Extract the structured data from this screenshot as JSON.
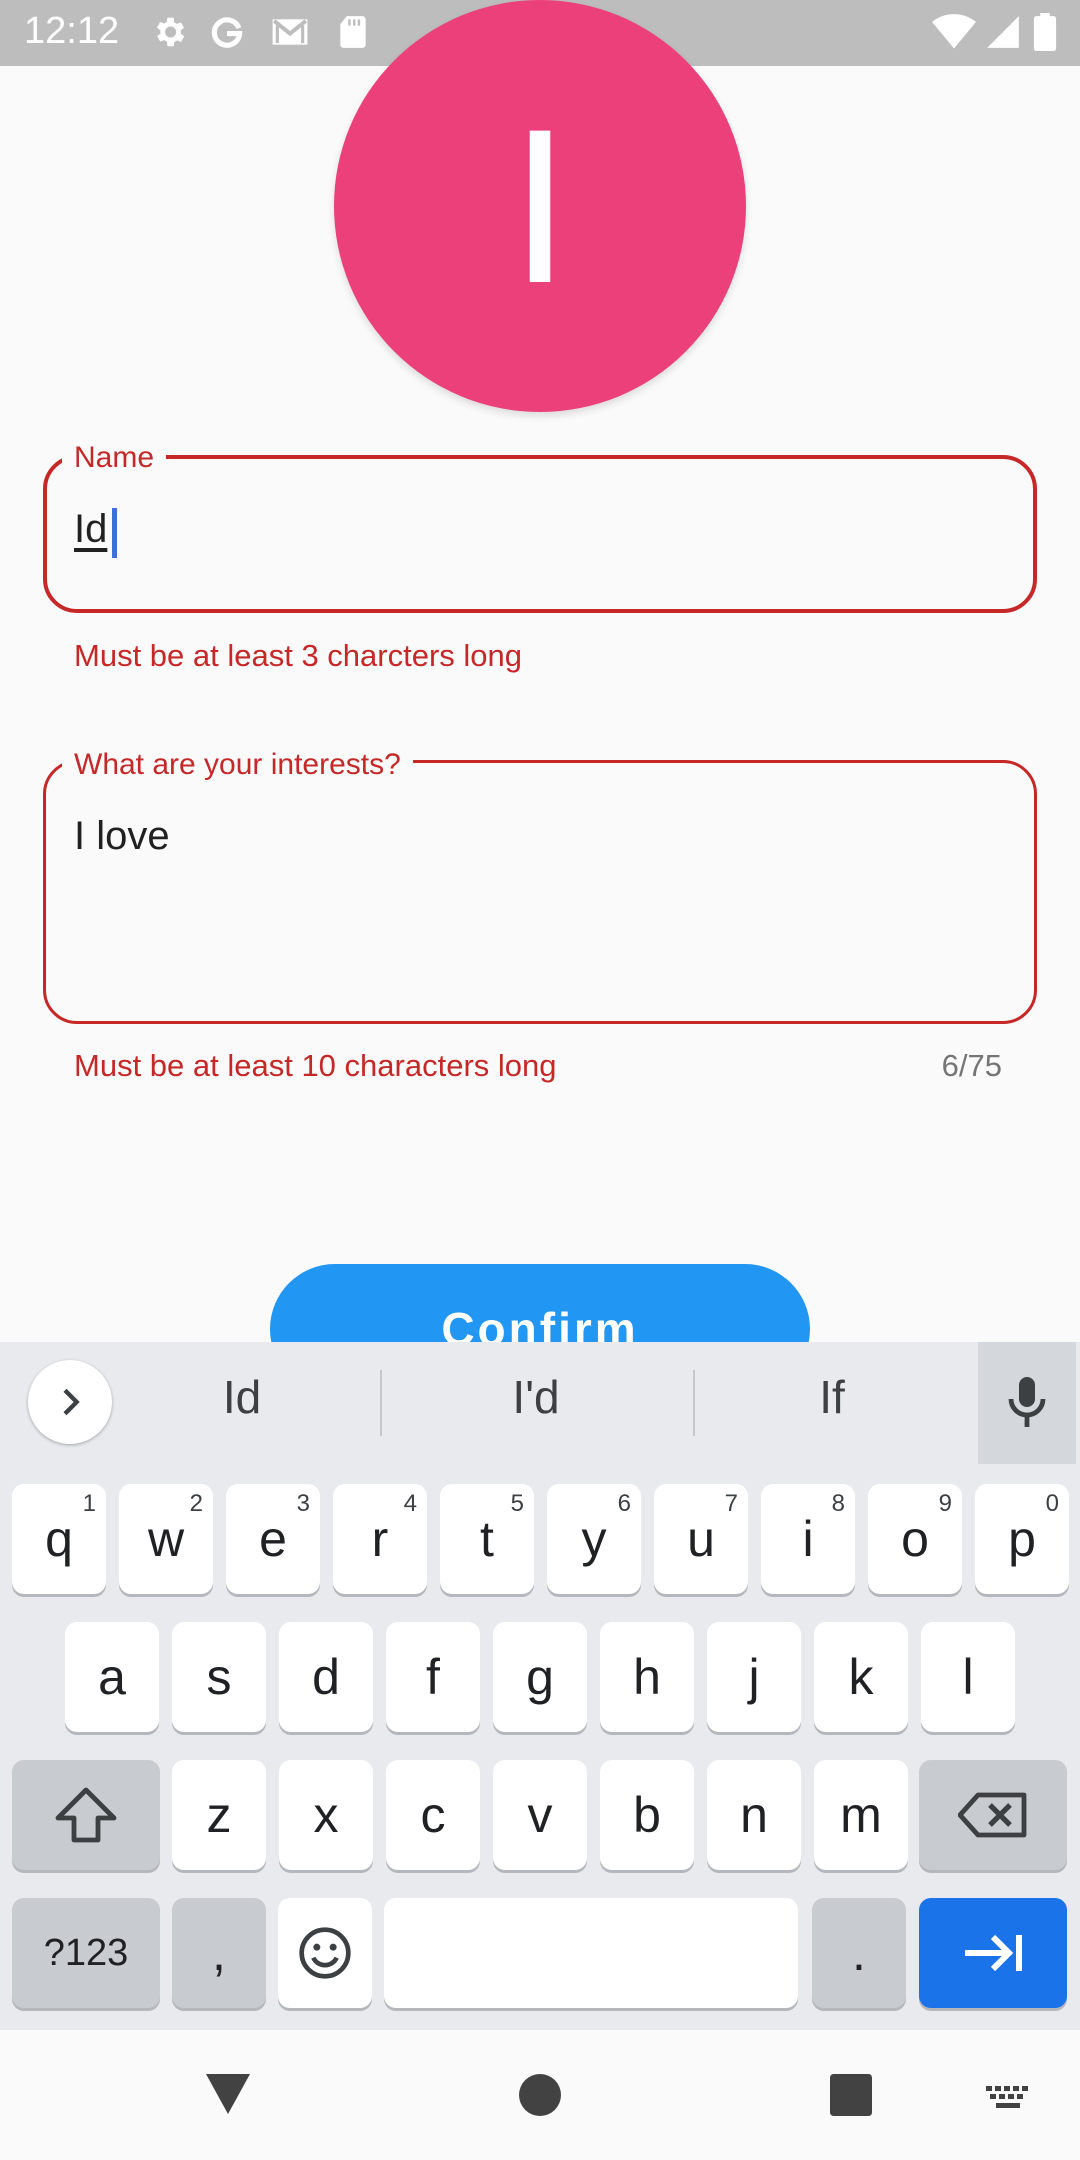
{
  "status_bar": {
    "time": "12:12",
    "icons": [
      "settings-icon",
      "google-icon",
      "gmail-icon",
      "sd-card-icon",
      "wifi-icon",
      "signal-icon",
      "battery-icon"
    ]
  },
  "avatar": {
    "initial": "I",
    "color": "#ec407a"
  },
  "form": {
    "name": {
      "label": "Name",
      "value": "Id",
      "error": "Must be at least 3 charcters long"
    },
    "interests": {
      "label": "What are your interests?",
      "value": "I love",
      "error": "Must be at least 10 characters long",
      "counter": "6/75"
    },
    "confirm_label": "Confirm",
    "error_color": "#c62828",
    "accent_color": "#2196f3"
  },
  "keyboard": {
    "suggestions": [
      "Id",
      "I'd",
      "If"
    ],
    "row1": [
      {
        "key": "q",
        "hint": "1"
      },
      {
        "key": "w",
        "hint": "2"
      },
      {
        "key": "e",
        "hint": "3"
      },
      {
        "key": "r",
        "hint": "4"
      },
      {
        "key": "t",
        "hint": "5"
      },
      {
        "key": "y",
        "hint": "6"
      },
      {
        "key": "u",
        "hint": "7"
      },
      {
        "key": "i",
        "hint": "8"
      },
      {
        "key": "o",
        "hint": "9"
      },
      {
        "key": "p",
        "hint": "0"
      }
    ],
    "row2": [
      "a",
      "s",
      "d",
      "f",
      "g",
      "h",
      "j",
      "k",
      "l"
    ],
    "row3": [
      "z",
      "x",
      "c",
      "v",
      "b",
      "n",
      "m"
    ],
    "symbols_label": "?123",
    "comma_label": ",",
    "period_label": "."
  }
}
